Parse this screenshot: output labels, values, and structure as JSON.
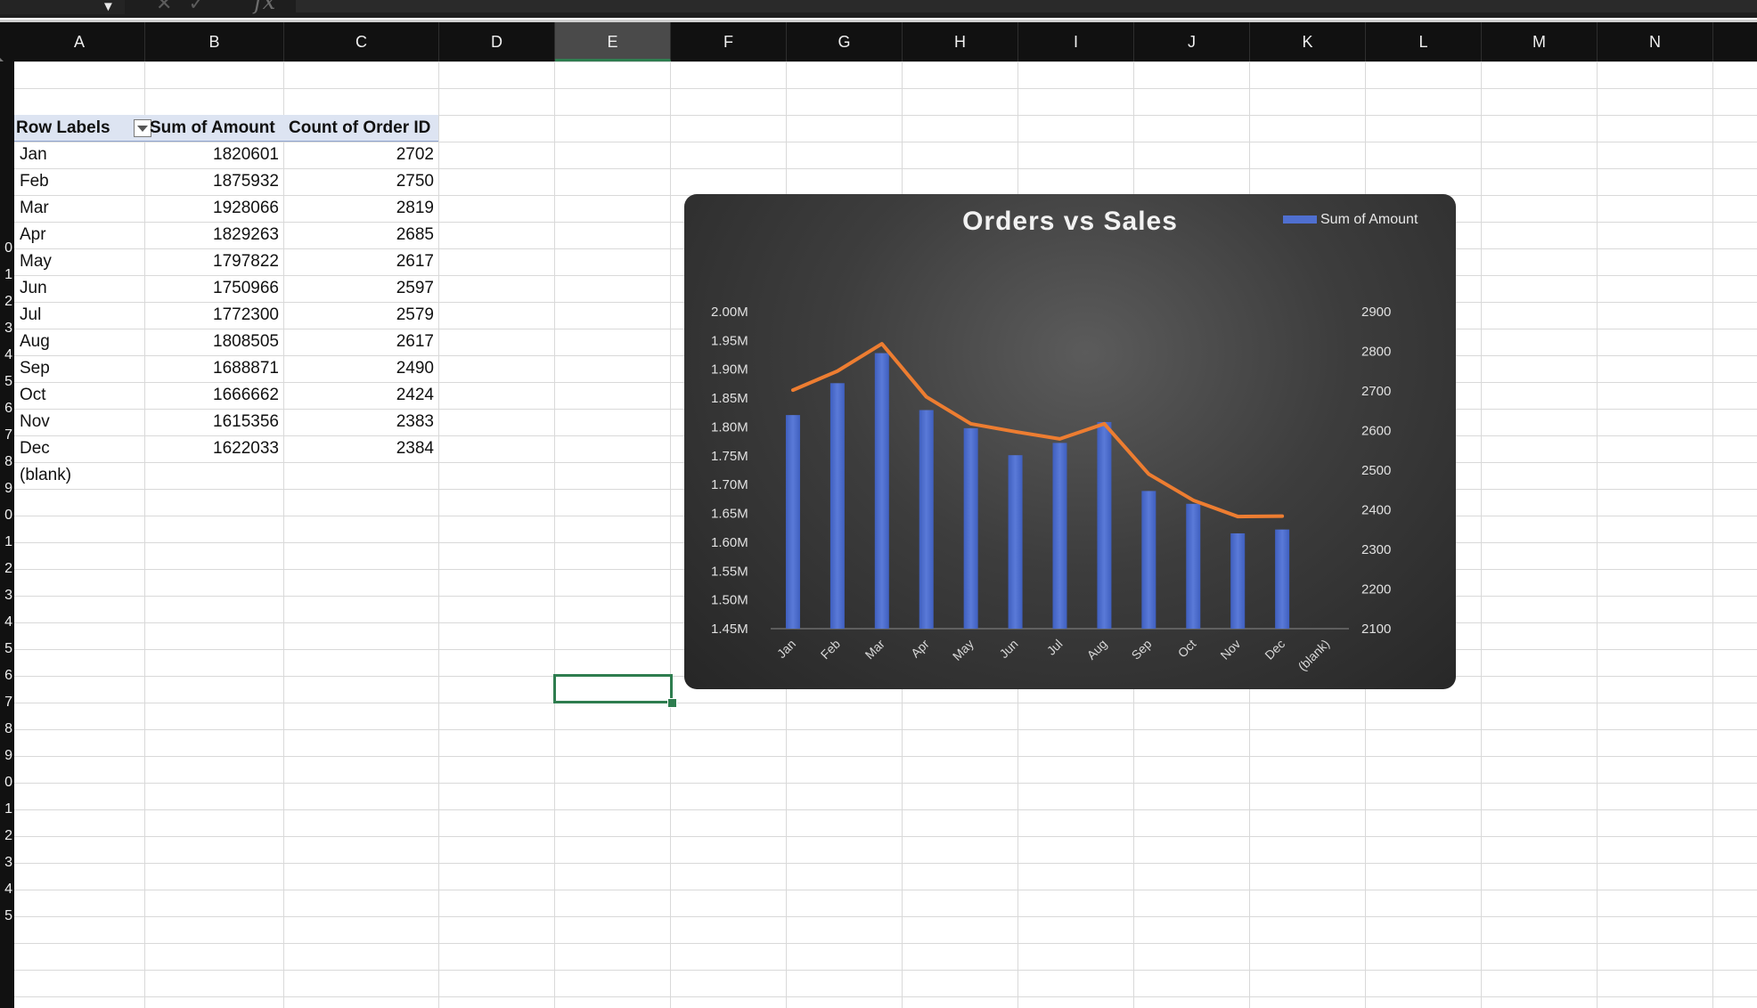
{
  "columns": [
    "A",
    "B",
    "C",
    "D",
    "E",
    "F",
    "G",
    "H",
    "I",
    "J",
    "K",
    "L",
    "M",
    "N"
  ],
  "selected_column": "E",
  "row_numbers": [
    "0",
    "1",
    "2",
    "3",
    "4",
    "5",
    "6",
    "7",
    "8",
    "9",
    "0",
    "1",
    "2",
    "3",
    "4",
    "5",
    "6",
    "7",
    "8",
    "9",
    "0",
    "1",
    "2",
    "3",
    "4",
    "5"
  ],
  "pivot": {
    "headers": [
      "Row Labels",
      "Sum of Amount",
      "Count of Order ID"
    ],
    "rows": [
      {
        "label": "Jan",
        "amount": "1820601",
        "count": "2702"
      },
      {
        "label": "Feb",
        "amount": "1875932",
        "count": "2750"
      },
      {
        "label": "Mar",
        "amount": "1928066",
        "count": "2819"
      },
      {
        "label": "Apr",
        "amount": "1829263",
        "count": "2685"
      },
      {
        "label": "May",
        "amount": "1797822",
        "count": "2617"
      },
      {
        "label": "Jun",
        "amount": "1750966",
        "count": "2597"
      },
      {
        "label": "Jul",
        "amount": "1772300",
        "count": "2579"
      },
      {
        "label": "Aug",
        "amount": "1808505",
        "count": "2617"
      },
      {
        "label": "Sep",
        "amount": "1688871",
        "count": "2490"
      },
      {
        "label": "Oct",
        "amount": "1666662",
        "count": "2424"
      },
      {
        "label": "Nov",
        "amount": "1615356",
        "count": "2383"
      },
      {
        "label": "Dec",
        "amount": "1622033",
        "count": "2384"
      },
      {
        "label": "(blank)",
        "amount": "",
        "count": ""
      }
    ]
  },
  "toolbar": {
    "fx_label": "fx",
    "cancel_icon": "x-icon",
    "confirm_icon": "check-icon",
    "namebox_arrow": "chevron-down-icon"
  },
  "chart_data": {
    "type": "bar",
    "title": "Orders vs Sales",
    "legend": [
      "Sum of Amount"
    ],
    "legend_position": "top-right",
    "categories": [
      "Jan",
      "Feb",
      "Mar",
      "Apr",
      "May",
      "Jun",
      "Jul",
      "Aug",
      "Sep",
      "Oct",
      "Nov",
      "Dec",
      "(blank)"
    ],
    "series": [
      {
        "name": "Sum of Amount",
        "type": "bar",
        "axis": "left",
        "color": "#4f6fd0",
        "values": [
          1820601,
          1875932,
          1928066,
          1829263,
          1797822,
          1750966,
          1772300,
          1808505,
          1688871,
          1666662,
          1615356,
          1622033,
          null
        ]
      },
      {
        "type": "line",
        "axis": "right",
        "color": "#ed7d31",
        "values": [
          2702,
          2750,
          2819,
          2685,
          2617,
          2597,
          2579,
          2617,
          2490,
          2424,
          2383,
          2384,
          null
        ]
      }
    ],
    "y_left": {
      "ticks": [
        "1.45M",
        "1.50M",
        "1.55M",
        "1.60M",
        "1.65M",
        "1.70M",
        "1.75M",
        "1.80M",
        "1.85M",
        "1.90M",
        "1.95M",
        "2.00M"
      ],
      "min": 1450000,
      "max": 2000000
    },
    "y_right": {
      "ticks": [
        "2100",
        "2200",
        "2300",
        "2400",
        "2500",
        "2600",
        "2700",
        "2800",
        "2900"
      ],
      "min": 2100,
      "max": 2900
    },
    "grid": false
  }
}
